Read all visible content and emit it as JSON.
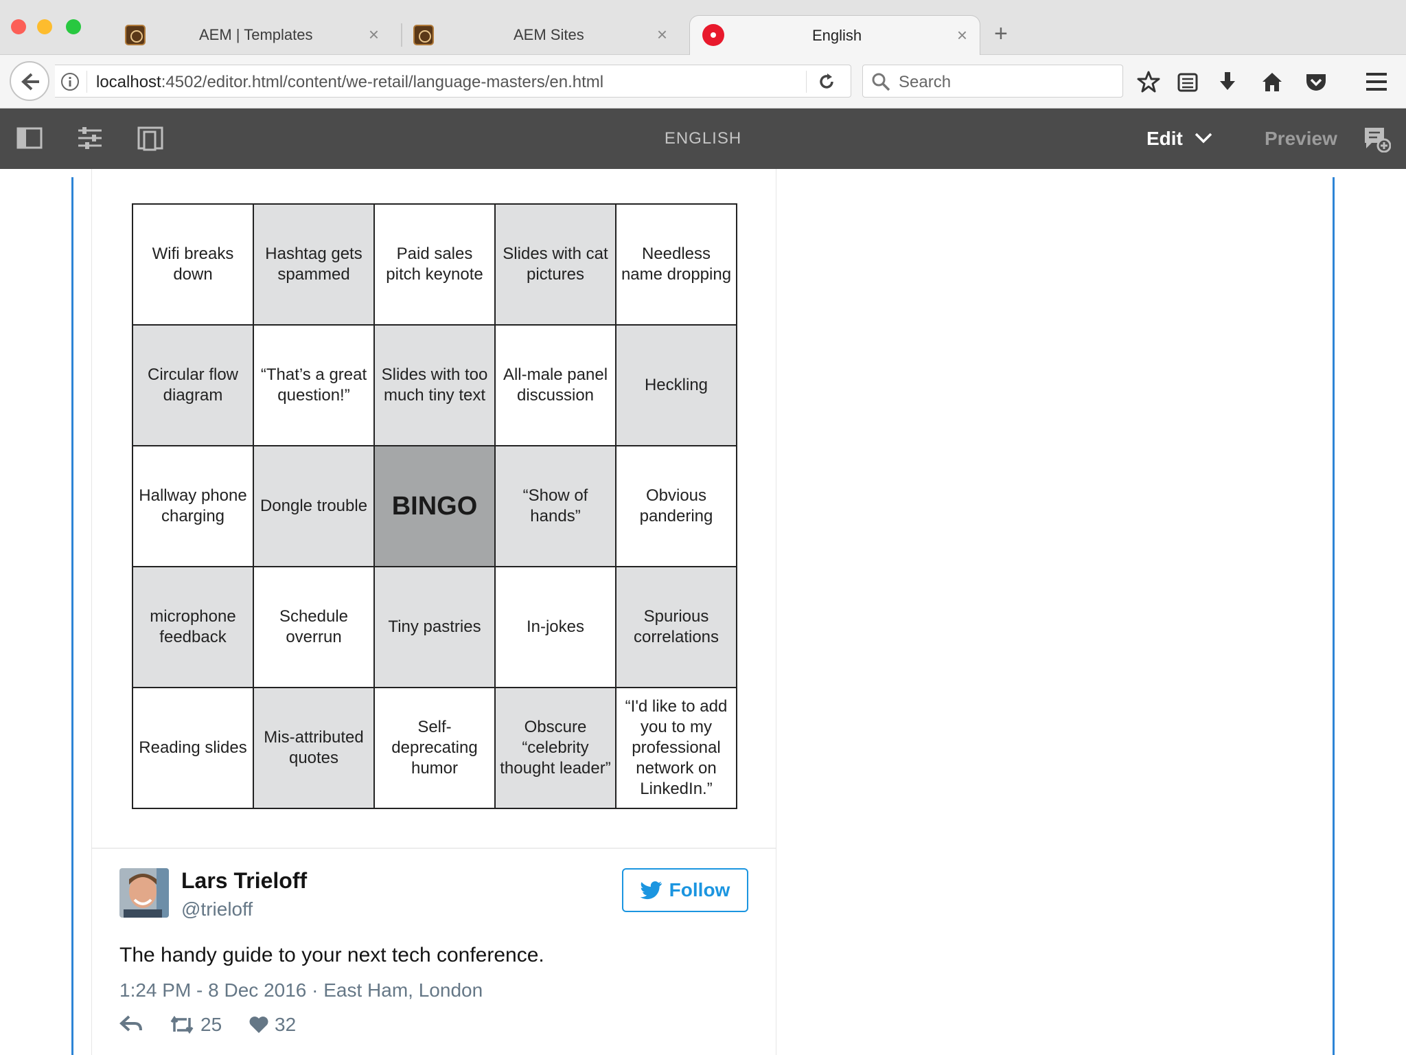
{
  "browser": {
    "tabs": [
      {
        "label": "AEM | Templates",
        "active": false
      },
      {
        "label": "AEM Sites",
        "active": false
      },
      {
        "label": "English",
        "active": true
      }
    ],
    "url_host": "localhost",
    "url_path": ":4502/editor.html/content/we-retail/language-masters/en.html",
    "search_placeholder": "Search"
  },
  "aem_toolbar": {
    "page_title": "ENGLISH",
    "mode_label": "Edit",
    "preview_label": "Preview"
  },
  "bingo": {
    "center_label": "BINGO",
    "rows": [
      [
        "Wifi breaks down",
        "Hashtag gets spammed",
        "Paid sales pitch keynote",
        "Slides with cat pictures",
        "Needless name dropping"
      ],
      [
        "Circular flow diagram",
        "“That’s a great question!”",
        "Slides with too much tiny text",
        "All-male panel discussion",
        "Heckling"
      ],
      [
        "Hallway phone charging",
        "Dongle trouble",
        "BINGO",
        "“Show of hands”",
        "Obvious pandering"
      ],
      [
        "microphone feedback",
        "Schedule overrun",
        "Tiny pastries",
        "In-jokes",
        "Spurious correlations"
      ],
      [
        "Reading slides",
        "Mis-attributed quotes",
        "Self-deprecating humor",
        "Obscure “celebrity thought leader”",
        "“I'd like to add you to my professional network on LinkedIn.”"
      ]
    ]
  },
  "tweet": {
    "author": "Lars Trieloff",
    "handle": "@trieloff",
    "follow_label": "Follow",
    "text": "The handy guide to your next tech conference.",
    "meta": "1:24 PM - 8 Dec 2016 · East Ham, London",
    "retweets": "25",
    "likes": "32"
  },
  "colors": {
    "toolbar_bg": "#4b4b4b",
    "accent_blue": "#2d84d6",
    "twitter_blue": "#1b95e0",
    "cell_gray": "#dfe0e1",
    "center_gray": "#a5a7a8"
  }
}
